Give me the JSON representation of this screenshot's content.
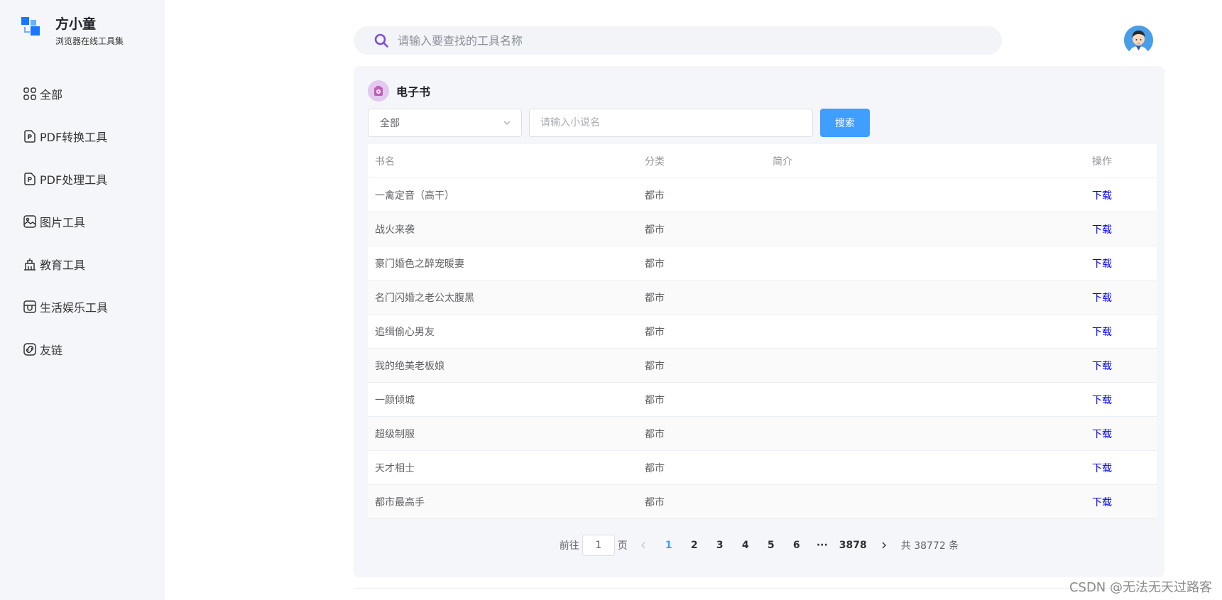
{
  "brand": {
    "name": "方小童",
    "subtitle": "浏览器在线工具集"
  },
  "sidebar": {
    "items": [
      {
        "label": "全部",
        "icon": "grid-icon"
      },
      {
        "label": "PDF转换工具",
        "icon": "pdf-icon"
      },
      {
        "label": "PDF处理工具",
        "icon": "pdf-icon"
      },
      {
        "label": "图片工具",
        "icon": "image-icon"
      },
      {
        "label": "教育工具",
        "icon": "education-icon"
      },
      {
        "label": "生活娱乐工具",
        "icon": "store-icon"
      },
      {
        "label": "友链",
        "icon": "link-icon"
      }
    ]
  },
  "search": {
    "placeholder": "请输入要查找的工具名称"
  },
  "panel": {
    "title": "电子书",
    "category_select": "全部",
    "novel_placeholder": "请输入小说名",
    "search_button": "搜索"
  },
  "table": {
    "columns": [
      "书名",
      "分类",
      "简介",
      "操作"
    ],
    "rows": [
      {
        "title": "一禽定音（高干）",
        "category": "都市",
        "intro": "",
        "action": "下载"
      },
      {
        "title": "战火来袭",
        "category": "都市",
        "intro": "",
        "action": "下载"
      },
      {
        "title": "豪门婚色之醉宠暖妻",
        "category": "都市",
        "intro": "",
        "action": "下载"
      },
      {
        "title": "名门闪婚之老公太腹黑",
        "category": "都市",
        "intro": "",
        "action": "下载"
      },
      {
        "title": "追缉偷心男友",
        "category": "都市",
        "intro": "",
        "action": "下载"
      },
      {
        "title": "我的绝美老板娘",
        "category": "都市",
        "intro": "",
        "action": "下载"
      },
      {
        "title": "一颜倾城",
        "category": "都市",
        "intro": "",
        "action": "下载"
      },
      {
        "title": "超级制服",
        "category": "都市",
        "intro": "",
        "action": "下载"
      },
      {
        "title": "天才相士",
        "category": "都市",
        "intro": "",
        "action": "下载"
      },
      {
        "title": "都市最高手",
        "category": "都市",
        "intro": "",
        "action": "下载"
      }
    ]
  },
  "pagination": {
    "goto_prefix": "前往",
    "goto_value": "1",
    "goto_suffix": "页",
    "pages": [
      "1",
      "2",
      "3",
      "4",
      "5",
      "6"
    ],
    "ellipsis": "···",
    "last_page": "3878",
    "total": "共 38772 条",
    "current": "1"
  },
  "watermark": "CSDN @无法无天过路客",
  "colors": {
    "accent": "#409eff",
    "link": "#0000ee",
    "search_icon": "#7b4fe0"
  }
}
